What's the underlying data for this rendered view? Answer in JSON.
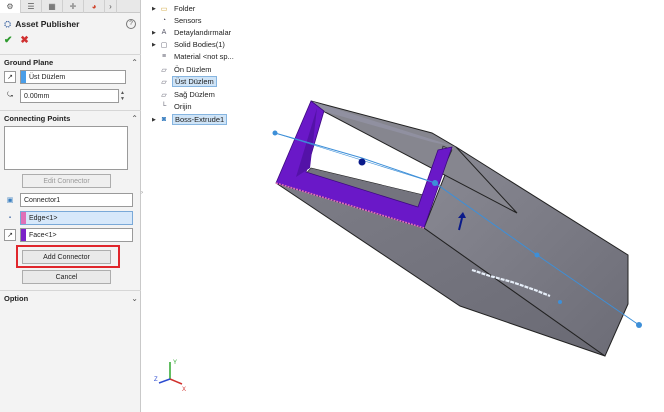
{
  "panel": {
    "title": "Asset Publisher",
    "ok_icon": "check-icon",
    "cancel_icon": "close-icon",
    "ground_plane": {
      "header": "Ground Plane",
      "plane_value": "Üst Düzlem",
      "offset_value": "0.00mm"
    },
    "connecting_points": {
      "header": "Connecting Points",
      "edit_connector_label": "Edit Connector",
      "connector_name": "Connector1",
      "edge_value": "Edge<1>",
      "face_value": "Face<1>",
      "add_connector_label": "Add Connector",
      "cancel_label": "Cancel"
    },
    "option": {
      "header": "Option"
    },
    "colors": {
      "plane_swatch": "#4a9ee8",
      "edge_swatch": "#e070b8",
      "face_swatch": "#7a22c8",
      "highlight": "#e0262c"
    }
  },
  "tree": {
    "items": [
      {
        "label": "Folder",
        "icon": "folder-icon",
        "expand": true
      },
      {
        "label": "Sensors",
        "icon": "sensors-icon",
        "expand": false
      },
      {
        "label": "Detaylandırmalar",
        "icon": "annotations-icon",
        "expand": true
      },
      {
        "label": "Solid Bodies(1)",
        "icon": "solid-bodies-icon",
        "expand": true
      },
      {
        "label": "Material <not sp...",
        "icon": "material-icon",
        "expand": false
      },
      {
        "label": "Ön Düzlem",
        "icon": "plane-icon",
        "expand": false
      },
      {
        "label": "Üst Düzlem",
        "icon": "plane-icon",
        "expand": false,
        "selected": true
      },
      {
        "label": "Sağ Düzlem",
        "icon": "plane-icon",
        "expand": false
      },
      {
        "label": "Orijin",
        "icon": "origin-icon",
        "expand": false
      },
      {
        "label": "Boss-Extrude1",
        "icon": "extrude-icon",
        "expand": true,
        "selected": true
      }
    ]
  },
  "viewport": {
    "model_color": "#76767f",
    "face_highlight": "#6a18c8",
    "preview_line": "#3d8fd8",
    "triad_labels": {
      "x": "X",
      "y": "Y",
      "z": "Z"
    }
  }
}
